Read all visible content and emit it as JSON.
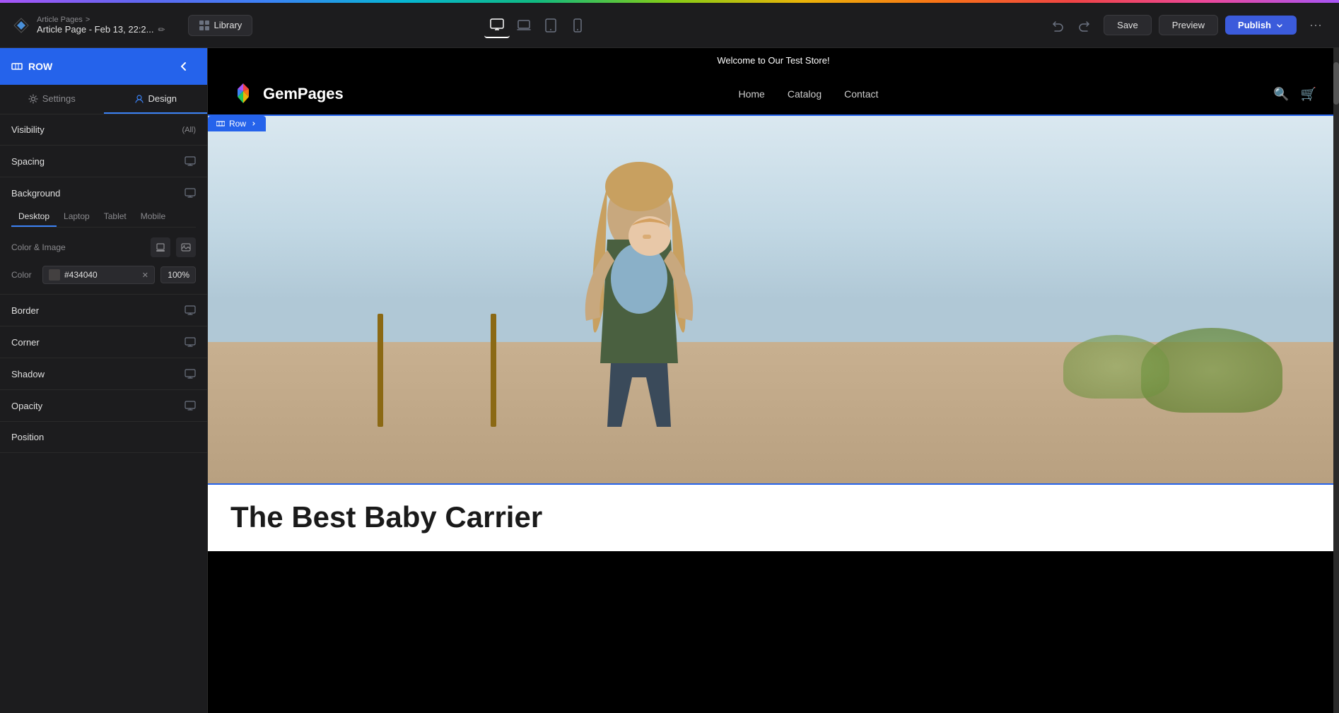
{
  "gradient_bar": {},
  "header": {
    "breadcrumb_parent": "Article Pages",
    "breadcrumb_separator": ">",
    "page_title": "Article Page - Feb 13, 22:2...",
    "library_label": "Library",
    "devices": [
      {
        "id": "desktop",
        "label": "Desktop",
        "icon": "🖥",
        "active": true
      },
      {
        "id": "laptop",
        "label": "Laptop",
        "icon": "💻",
        "active": false
      },
      {
        "id": "tablet",
        "label": "Tablet",
        "icon": "⬜",
        "active": false
      },
      {
        "id": "mobile",
        "label": "Mobile",
        "icon": "📱",
        "active": false
      }
    ],
    "save_label": "Save",
    "preview_label": "Preview",
    "publish_label": "Publish",
    "more_icon": "···"
  },
  "left_panel": {
    "panel_title": "ROW",
    "back_icon": "←",
    "tabs": [
      {
        "id": "settings",
        "label": "Settings",
        "icon": "⚙",
        "active": false
      },
      {
        "id": "design",
        "label": "Design",
        "icon": "🎨",
        "active": true
      }
    ],
    "sections": {
      "visibility": {
        "title": "Visibility",
        "badge": "(All)"
      },
      "spacing": {
        "title": "Spacing",
        "icon": "🖥"
      },
      "background": {
        "title": "Background",
        "icon": "🖥",
        "tabs": [
          "Desktop",
          "Laptop",
          "Tablet",
          "Mobile"
        ],
        "active_tab": "Desktop",
        "subsections": {
          "color_image_label": "Color & Image",
          "color_icon": "🎨",
          "image_icon": "🖼"
        },
        "color": {
          "label": "Color",
          "hex": "#434040",
          "opacity": "100%"
        }
      },
      "border": {
        "title": "Border",
        "icon": "🖥"
      },
      "corner": {
        "title": "Corner",
        "icon": "🖥"
      },
      "shadow": {
        "title": "Shadow",
        "icon": "🖥"
      },
      "opacity": {
        "title": "Opacity",
        "icon": "🖥"
      },
      "position": {
        "title": "Position"
      }
    }
  },
  "canvas": {
    "store_banner": "Welcome to Our Test Store!",
    "nav": {
      "logo_text": "GemPages",
      "links": [
        "Home",
        "Catalog",
        "Contact"
      ]
    },
    "row_badge": "Row",
    "hero": {
      "image_alt": "Mother holding baby in carrier outdoors"
    },
    "article": {
      "title": "The Best Baby Carrier"
    }
  }
}
